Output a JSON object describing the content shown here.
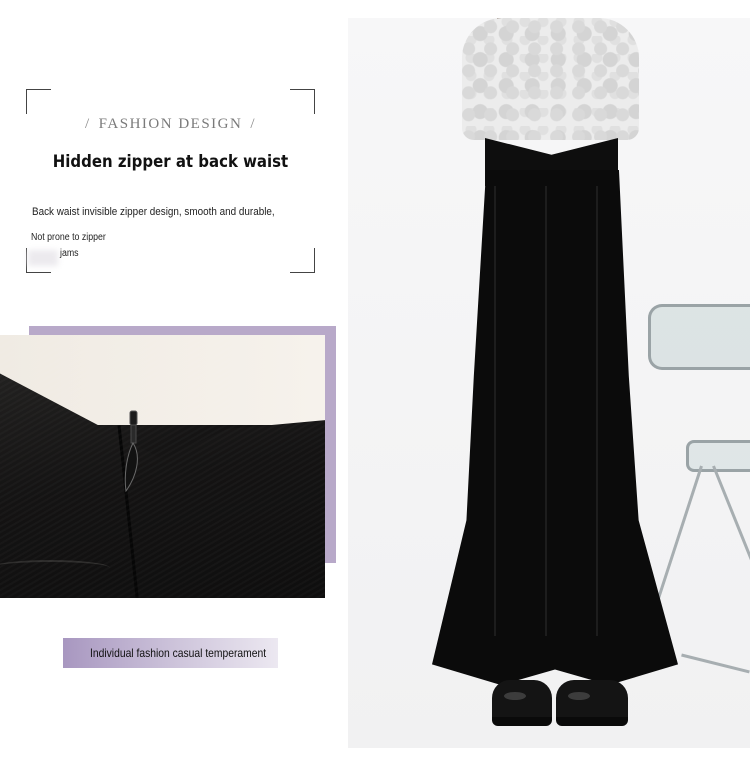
{
  "header": {
    "eyebrow": "FASHION DESIGN",
    "title": "Hidden zipper at back waist",
    "description_line1": "Back waist invisible zipper design, smooth and durable,",
    "description_line2": "Not prone to zipper",
    "description_line3": "jams"
  },
  "tag": {
    "label": "Individual fashion casual temperament"
  },
  "colors": {
    "accent_lilac": "#b8a9c9",
    "skirt_black": "#0b0b0b",
    "text_dark": "#111111"
  },
  "images": {
    "detail_photo": "zipper-detail-photo",
    "model_photo": "mermaid-skirt-model-photo"
  }
}
